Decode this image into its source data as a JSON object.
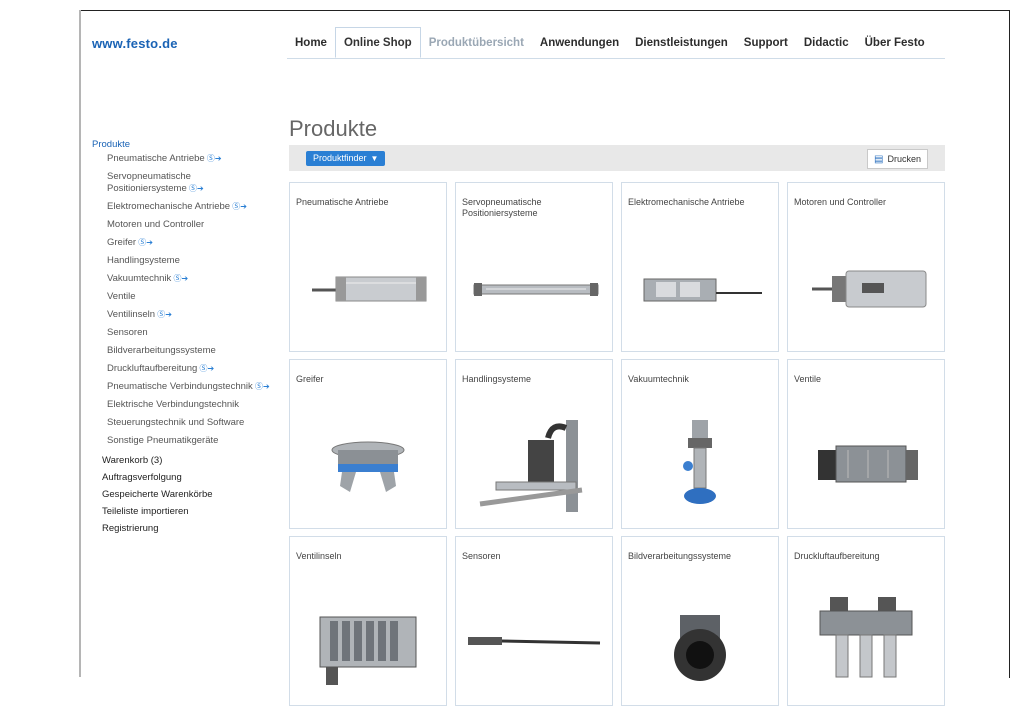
{
  "site": {
    "logo": "www.festo.de"
  },
  "nav": [
    {
      "label": "Home",
      "state": "normal"
    },
    {
      "label": "Online Shop",
      "state": "active"
    },
    {
      "label": "Produktübersicht",
      "state": "light"
    },
    {
      "label": "Anwendungen",
      "state": "normal"
    },
    {
      "label": "Dienstleistungen",
      "state": "normal"
    },
    {
      "label": "Support",
      "state": "normal"
    },
    {
      "label": "Didactic",
      "state": "normal"
    },
    {
      "label": "Über Festo",
      "state": "normal"
    }
  ],
  "page": {
    "title": "Produkte"
  },
  "toolbar": {
    "produktfinder_label": "Produktfinder",
    "print_label": "Drucken"
  },
  "sidebar": {
    "heading": "Produkte",
    "items": [
      {
        "label": "Pneumatische Antriebe",
        "more": true
      },
      {
        "label": "Servopneumatische Positioniersysteme",
        "more": true
      },
      {
        "label": "Elektromechanische Antriebe",
        "more": true
      },
      {
        "label": "Motoren und Controller",
        "more": false
      },
      {
        "label": "Greifer",
        "more": true
      },
      {
        "label": "Handlingsysteme",
        "more": false
      },
      {
        "label": "Vakuumtechnik",
        "more": true
      },
      {
        "label": "Ventile",
        "more": false
      },
      {
        "label": "Ventilinseln",
        "more": true
      },
      {
        "label": "Sensoren",
        "more": false
      },
      {
        "label": "Bildverarbeitungssysteme",
        "more": false
      },
      {
        "label": "Druckluftaufbereitung",
        "more": true
      },
      {
        "label": "Pneumatische Verbindungstechnik",
        "more": true
      },
      {
        "label": "Elektrische Verbindungstechnik",
        "more": false
      },
      {
        "label": "Steuerungstechnik und Software",
        "more": false
      },
      {
        "label": "Sonstige Pneumatikgeräte",
        "more": false
      }
    ],
    "bottom_links": [
      "Warenkorb (3)",
      "Auftragsverfolgung",
      "Gespeicherte Warenkörbe",
      "Teileliste importieren",
      "Registrierung"
    ]
  },
  "products": [
    {
      "label": "Pneumatische Antriebe",
      "icon": "cylinder-icon"
    },
    {
      "label": "Servopneumatische Positioniersysteme",
      "icon": "servo-icon"
    },
    {
      "label": "Elektromechanische Antriebe",
      "icon": "axis-icon"
    },
    {
      "label": "Motoren und Controller",
      "icon": "motor-icon"
    },
    {
      "label": "Greifer",
      "icon": "gripper-icon"
    },
    {
      "label": "Handlingsysteme",
      "icon": "handling-icon"
    },
    {
      "label": "Vakuumtechnik",
      "icon": "vacuum-icon"
    },
    {
      "label": "Ventile",
      "icon": "valve-icon"
    },
    {
      "label": "Ventilinseln",
      "icon": "valve-terminal-icon"
    },
    {
      "label": "Sensoren",
      "icon": "sensor-icon"
    },
    {
      "label": "Bildverarbeitungssysteme",
      "icon": "camera-icon"
    },
    {
      "label": "Druckluftaufbereitung",
      "icon": "air-prep-icon"
    }
  ],
  "colors": {
    "accent": "#2a7fd4",
    "link": "#1a63b5",
    "border": "#d2dde8"
  }
}
